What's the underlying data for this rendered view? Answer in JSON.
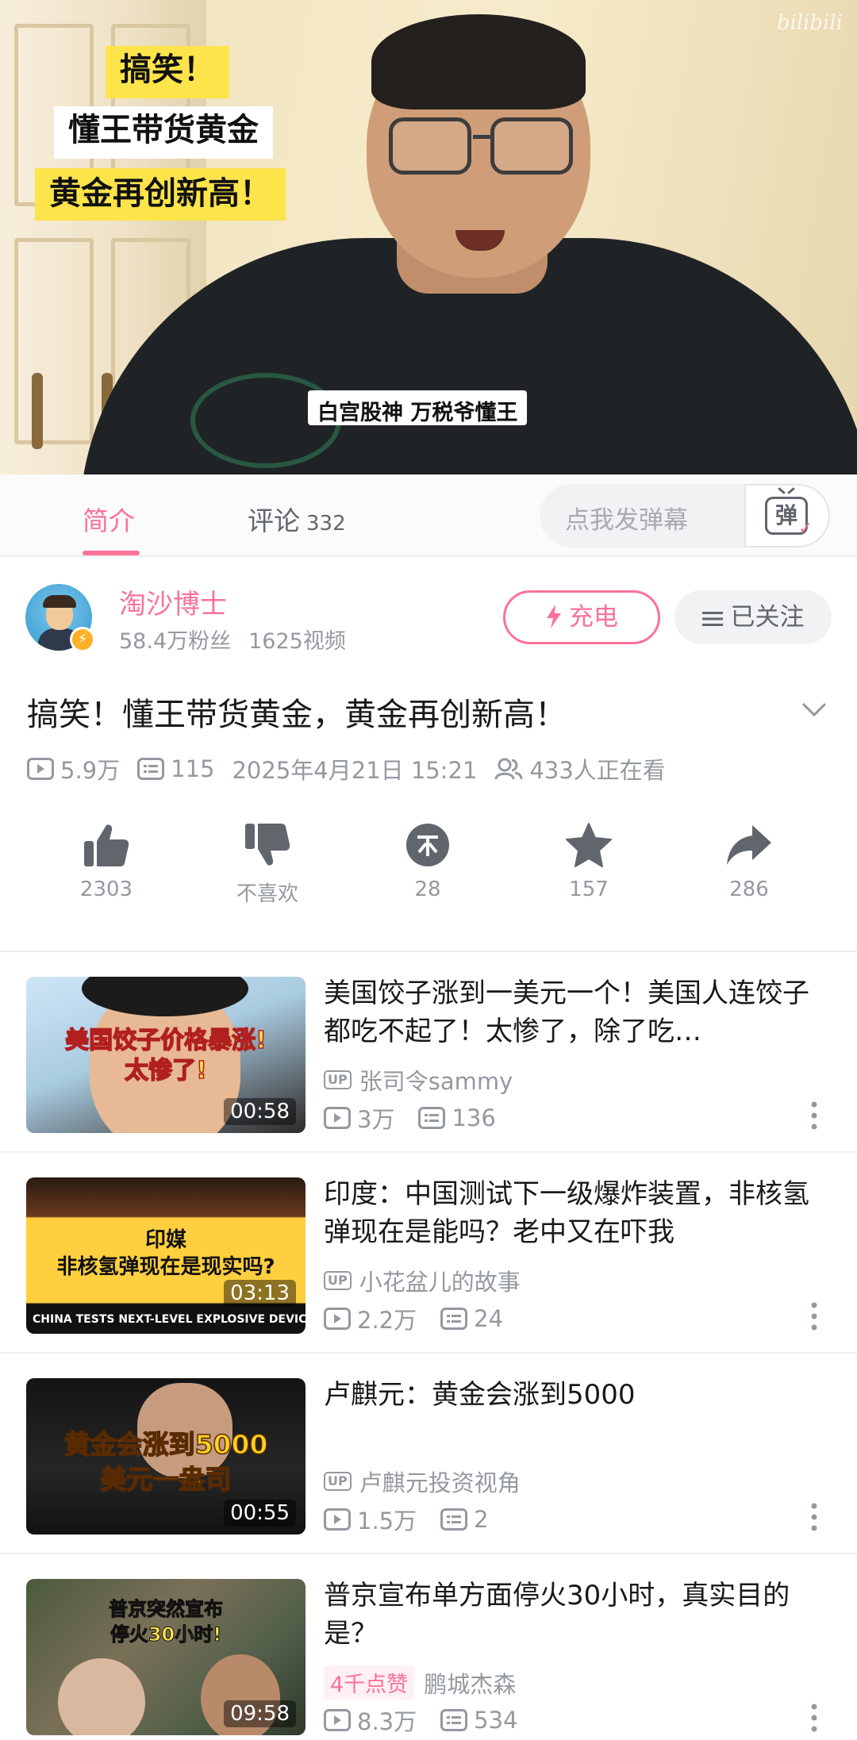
{
  "player": {
    "tag_line_1": "搞笑！",
    "tag_line_2": "懂王带货黄金",
    "tag_line_3": "黄金再创新高！",
    "subtitle": "白宫股神 万税爷懂王",
    "watermark": "bilibili"
  },
  "tabs": {
    "intro_label": "简介",
    "comments_label": "评论",
    "comments_count": "332",
    "danmaku_placeholder": "点我发弹幕",
    "danmaku_button": "弹"
  },
  "uploader": {
    "name": "淘沙博士",
    "followers": "58.4万粉丝",
    "videos": "1625视频",
    "charge_label": "充电",
    "follow_label": "已关注"
  },
  "video": {
    "title": "搞笑！懂王带货黄金，黄金再创新高！",
    "views": "5.9万",
    "danmaku_count": "115",
    "publish_time": "2025年4月21日 15:21",
    "watching_now": "433人正在看"
  },
  "actions": {
    "like_count": "2303",
    "dislike_label": "不喜欢",
    "coin_count": "28",
    "favorite_count": "157",
    "share_count": "286"
  },
  "recommendations": [
    {
      "title": "美国饺子涨到一美元一个！美国人连饺子都吃不起了！太惨了，除了吃…",
      "author": "张司令sammy",
      "views": "3万",
      "danmaku": "136",
      "duration": "00:58",
      "thumb_text_1": "美国饺子价格暴涨!",
      "thumb_text_2": "太惨了!"
    },
    {
      "title": "印度：中国测试下一级爆炸装置，非核氢弹现在是能吗？老中又在吓我",
      "author": "小花盆儿的故事",
      "views": "2.2万",
      "danmaku": "24",
      "duration": "03:13",
      "thumb_text_1": "印媒",
      "thumb_text_2": "非核氢弹现在是现实吗?",
      "thumb_band": "CHINA TESTS NEXT-LEVEL EXPLOSIVE DEVICE"
    },
    {
      "title": "卢麒元：黄金会涨到5000",
      "author": "卢麒元投资视角",
      "views": "1.5万",
      "danmaku": "2",
      "duration": "00:55",
      "thumb_text_1": "黄金会涨到5000",
      "thumb_text_2": "美元一盎司"
    },
    {
      "title": "普京宣布单方面停火30小时，真实目的是？",
      "likes_badge": "4千点赞",
      "author": "鹏城杰森",
      "views": "8.3万",
      "danmaku": "534",
      "duration": "09:58",
      "thumb_text_1": "普京突然宣布",
      "thumb_text_2": "停火30小时!"
    }
  ],
  "icons": {
    "up_tag": "UP",
    "accent_color": "#fb7299"
  }
}
